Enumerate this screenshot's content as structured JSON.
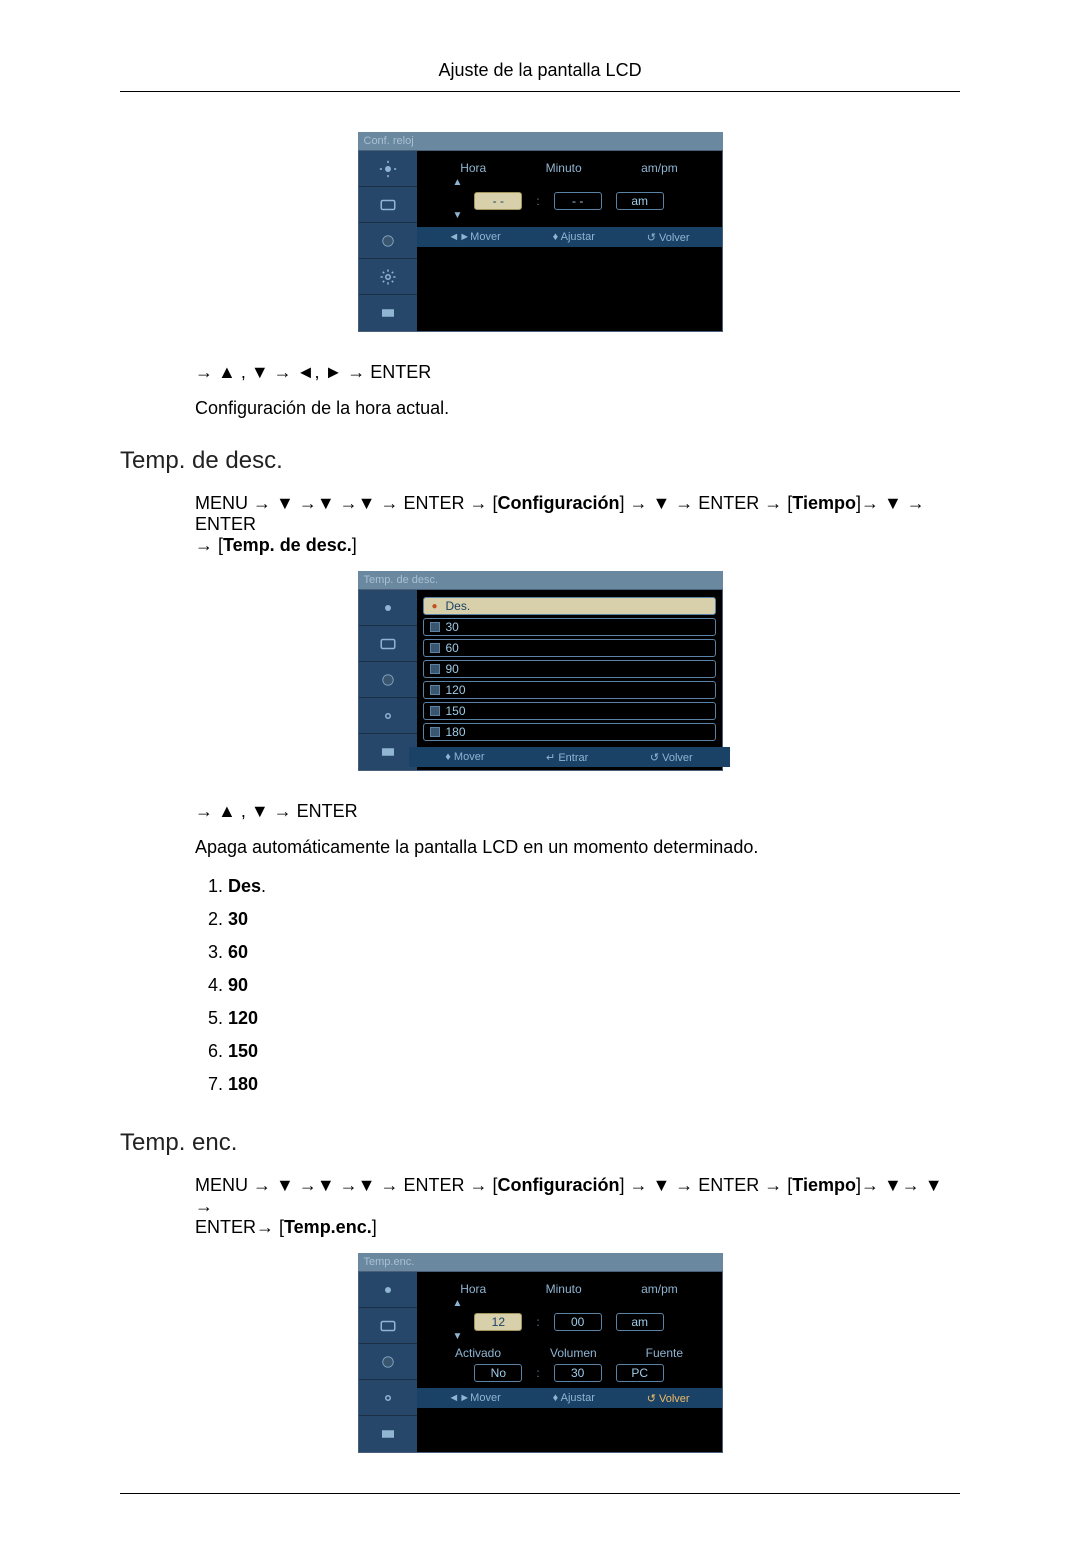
{
  "page": {
    "header": "Ajuste de la pantalla LCD"
  },
  "figure1": {
    "titlebar": "Conf. reloj",
    "labels": {
      "hora": "Hora",
      "minuto": "Minuto",
      "ampm": "am/pm"
    },
    "values": {
      "hora": "- -",
      "minuto": "- -",
      "ampm": "am"
    },
    "bottom": {
      "mover": "◄►Mover",
      "ajustar": "♦ Ajustar",
      "volver": "↺ Volver"
    }
  },
  "seq1": "→ ▲ , ▼ → ◄, ► → ENTER",
  "text_conf_hora": "Configuración de la hora actual.",
  "section_temp_desc": "Temp. de desc.",
  "seq2": {
    "a": "MENU → ▼ →▼ →▼ → ENTER → [",
    "conf": "Configuración",
    "b": "] → ▼ → ENTER → [",
    "tiempo": "Tiempo",
    "c": "]→ ▼ → ENTER",
    "d": "→ [",
    "tdd": "Temp. de desc.",
    "e": "]"
  },
  "figure2": {
    "titlebar": "Temp. de desc.",
    "items": [
      "Des.",
      "30",
      "60",
      "90",
      "120",
      "150",
      "180"
    ],
    "bottom": {
      "mover": "♦ Mover",
      "entrar": "↵ Entrar",
      "volver": "↺ Volver"
    }
  },
  "seq3": "→ ▲ , ▼ → ENTER",
  "text_apaga": "Apaga automáticamente la pantalla LCD en un momento determinado.",
  "options": [
    {
      "n": "1",
      "label": "Des",
      "punct": "."
    },
    {
      "n": "2",
      "label": "30",
      "punct": ""
    },
    {
      "n": "3",
      "label": "60",
      "punct": ""
    },
    {
      "n": "4",
      "label": "90",
      "punct": ""
    },
    {
      "n": "5",
      "label": "120",
      "punct": ""
    },
    {
      "n": "6",
      "label": "150",
      "punct": ""
    },
    {
      "n": "7",
      "label": "180",
      "punct": ""
    }
  ],
  "section_temp_enc": "Temp. enc.",
  "seq4": {
    "a": "MENU → ▼ →▼ →▼ → ENTER → [",
    "conf": "Configuración",
    "b": "] → ▼ → ENTER → [",
    "tiempo": "Tiempo",
    "c": "]→ ▼→ ▼ →",
    "d": "ENTER→ [",
    "te": "Temp.enc.",
    "e": "]"
  },
  "figure3": {
    "titlebar": "Temp.enc.",
    "labels_top": {
      "hora": "Hora",
      "minuto": "Minuto",
      "ampm": "am/pm"
    },
    "values_top": {
      "hora": "12",
      "minuto": "00",
      "ampm": "am"
    },
    "labels_bot": {
      "activado": "Activado",
      "volumen": "Volumen",
      "fuente": "Fuente"
    },
    "values_bot": {
      "activado": "No",
      "volumen": "30",
      "fuente": "PC"
    },
    "bottom": {
      "mover": "◄►Mover",
      "ajustar": "♦ Ajustar",
      "volver": "↺ Volver"
    }
  }
}
